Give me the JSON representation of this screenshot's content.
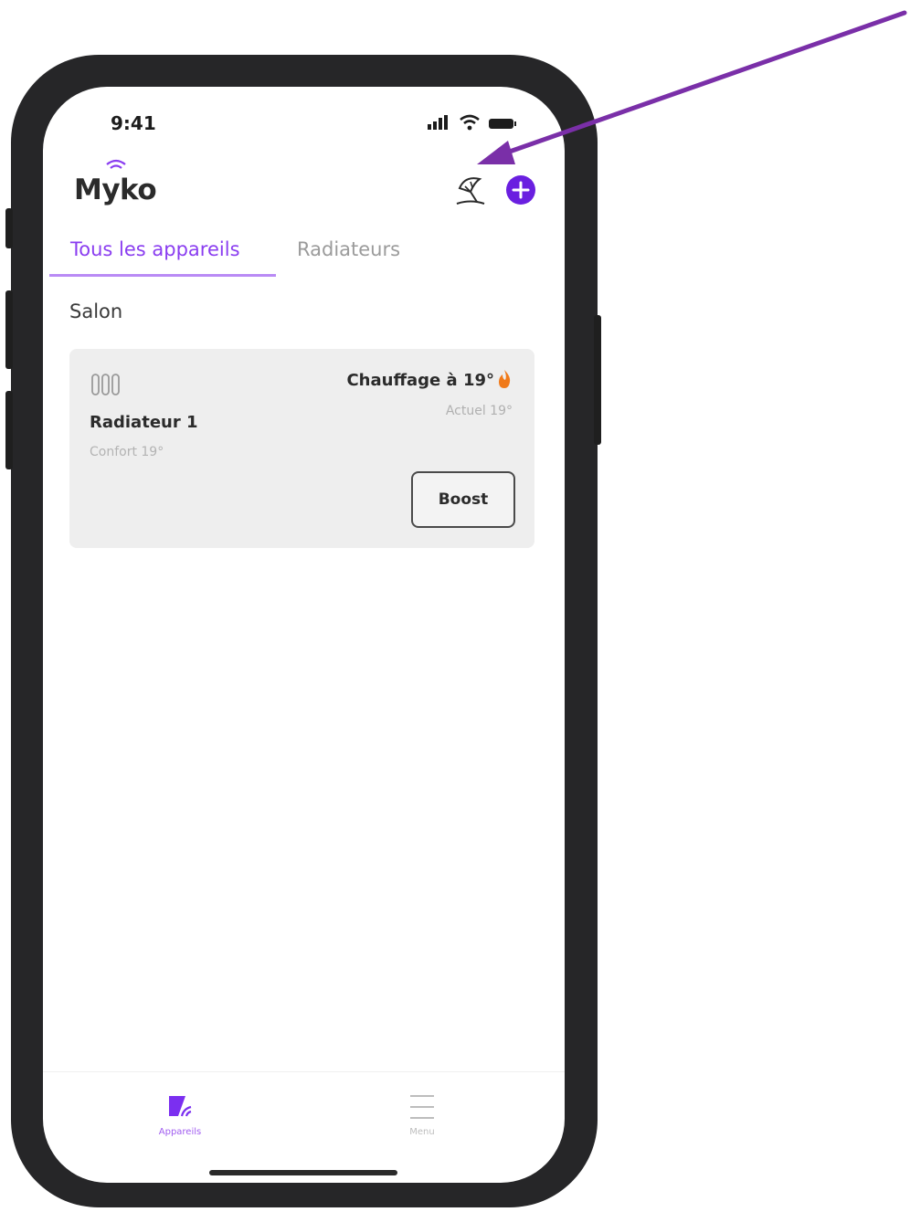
{
  "status_bar": {
    "time": "9:41"
  },
  "header": {
    "logo": "Myko"
  },
  "tabs": [
    {
      "label": "Tous les appareils",
      "active": true
    },
    {
      "label": "Radiateurs",
      "active": false
    }
  ],
  "section_title": "Salon",
  "device": {
    "name": "Radiateur 1",
    "mode": "Confort 19°",
    "status": "Chauffage à 19°",
    "actual": "Actuel 19°",
    "boost_label": "Boost"
  },
  "bottom_nav": [
    {
      "label": "Appareils",
      "active": true
    },
    {
      "label": "Menu",
      "active": false
    }
  ],
  "colors": {
    "accent": "#6a1fe0",
    "active_tab": "#8a3df0",
    "flame": "#f07a1a",
    "annotation_arrow": "#7a2fa8"
  },
  "icons": [
    "signal-icon",
    "wifi-icon",
    "battery-icon",
    "beach-umbrella-icon",
    "add-icon",
    "radiator-icon",
    "flame-icon",
    "devices-icon",
    "menu-icon"
  ]
}
